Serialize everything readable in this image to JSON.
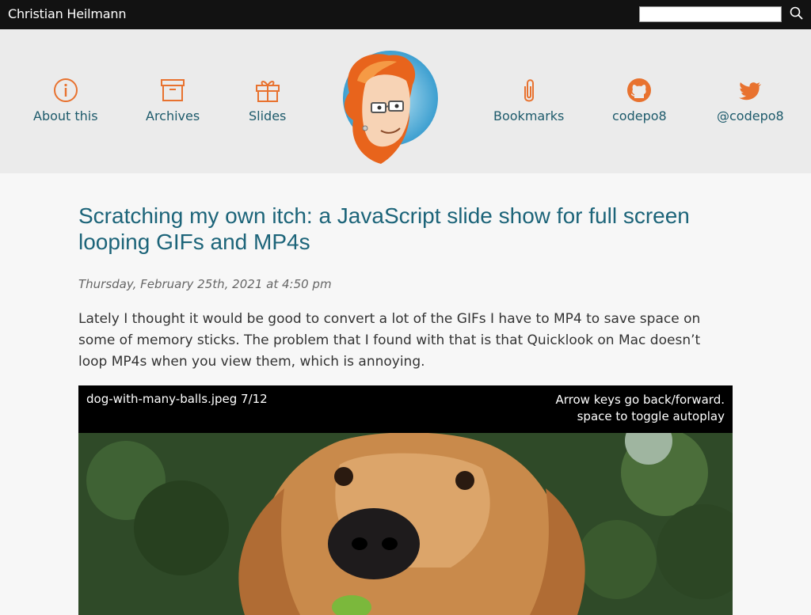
{
  "header": {
    "site_title": "Christian Heilmann",
    "search_placeholder": ""
  },
  "nav": {
    "left": [
      {
        "label": "About this",
        "icon": "info-icon"
      },
      {
        "label": "Archives",
        "icon": "archive-icon"
      },
      {
        "label": "Slides",
        "icon": "gift-icon"
      }
    ],
    "right": [
      {
        "label": "Bookmarks",
        "icon": "paperclip-icon"
      },
      {
        "label": "codepo8",
        "icon": "github-icon"
      },
      {
        "label": "@codepo8",
        "icon": "twitter-icon"
      }
    ]
  },
  "article": {
    "title": "Scratching my own itch: a JavaScript slide show for full screen looping GIFs and MP4s",
    "date": "Thursday, February 25th, 2021 at 4:50 pm",
    "intro": "Lately I thought it would be good to convert a lot of the GIFs I have to MP4 to save space on some of memory sticks. The problem that I found with that is that Quicklook on Mac doesn’t loop MP4s when you view them, which is annoying."
  },
  "slideshow": {
    "caption": "dog-with-many-balls.jpeg 7/12",
    "help_line1": "Arrow keys go back/forward.",
    "help_line2": "space to toggle autoplay"
  },
  "colors": {
    "accent": "#e8722f",
    "link": "#1d5a6b",
    "title": "#1c6479",
    "topbar": "#121212"
  }
}
